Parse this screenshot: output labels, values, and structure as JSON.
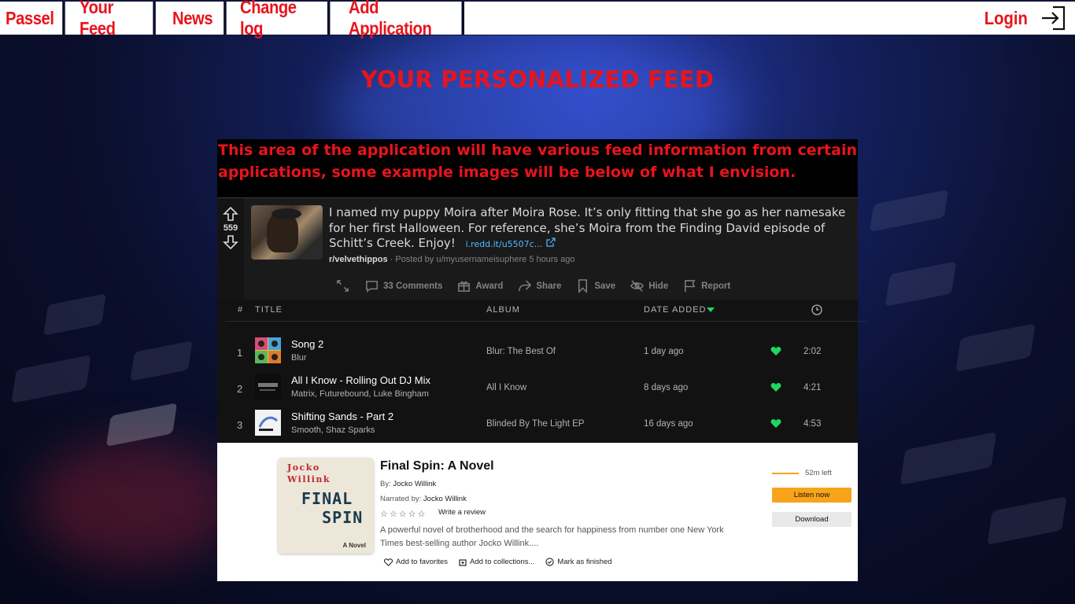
{
  "nav": {
    "items": [
      "Passel",
      "Your Feed",
      "News",
      "Change log",
      "Add Application"
    ],
    "login_label": "Login"
  },
  "page": {
    "title": "YOUR PERSONALIZED FEED",
    "intro": "This area of the application will have various feed information from certain applications, some example images will be below of what I envision."
  },
  "reddit": {
    "vote_count": "559",
    "post_title": "I named my puppy Moira after Moira Rose. It’s only fitting that she go as her namesake for her first Halloween. For reference, she’s Moira from the Finding David episode of Schitt’s Creek. Enjoy!",
    "link_text": "i.redd.it/u5507c...",
    "subreddit": "r/velvethippos",
    "meta": " · Posted by u/myusernameisuphere 5 hours ago",
    "actions": {
      "comments": "33 Comments",
      "award": "Award",
      "share": "Share",
      "save": "Save",
      "hide": "Hide",
      "report": "Report"
    }
  },
  "spotify": {
    "headers": {
      "num": "#",
      "title": "TITLE",
      "album": "ALBUM",
      "date": "DATE ADDED"
    },
    "accent": "#1ed760",
    "tracks": [
      {
        "num": "1",
        "title": "Song 2",
        "artist": "Blur",
        "album": "Blur: The Best Of",
        "date": "1 day ago",
        "duration": "2:02"
      },
      {
        "num": "2",
        "title": "All I Know - Rolling Out DJ Mix",
        "artist": "Matrix, Futurebound, Luke Bingham",
        "album": "All I Know",
        "date": "8 days ago",
        "duration": "4:21"
      },
      {
        "num": "3",
        "title": "Shifting Sands - Part 2",
        "artist": "Smooth, Shaz Sparks",
        "album": "Blinded By The Light EP",
        "date": "16 days ago",
        "duration": "4:53"
      }
    ]
  },
  "audible": {
    "cover": {
      "author": "Jocko\nWillink",
      "title": "FINAL\n  SPIN",
      "sub": "A Novel"
    },
    "title": "Final Spin: A Novel",
    "by_label": "By:",
    "author": "Jocko Willink",
    "narrated_label": "Narrated by:",
    "narrator": "Jocko Willink",
    "write_review": "Write a review",
    "description": "A powerful novel of brotherhood and the search for happiness from number one New York Times best-selling author Jocko Willink....",
    "time_left": "52m left",
    "listen_label": "Listen now",
    "download_label": "Download",
    "actions": {
      "favorites": "Add to favorites",
      "collections": "Add to collections...",
      "finished": "Mark as finished"
    },
    "progress_fraction": 0.2
  }
}
